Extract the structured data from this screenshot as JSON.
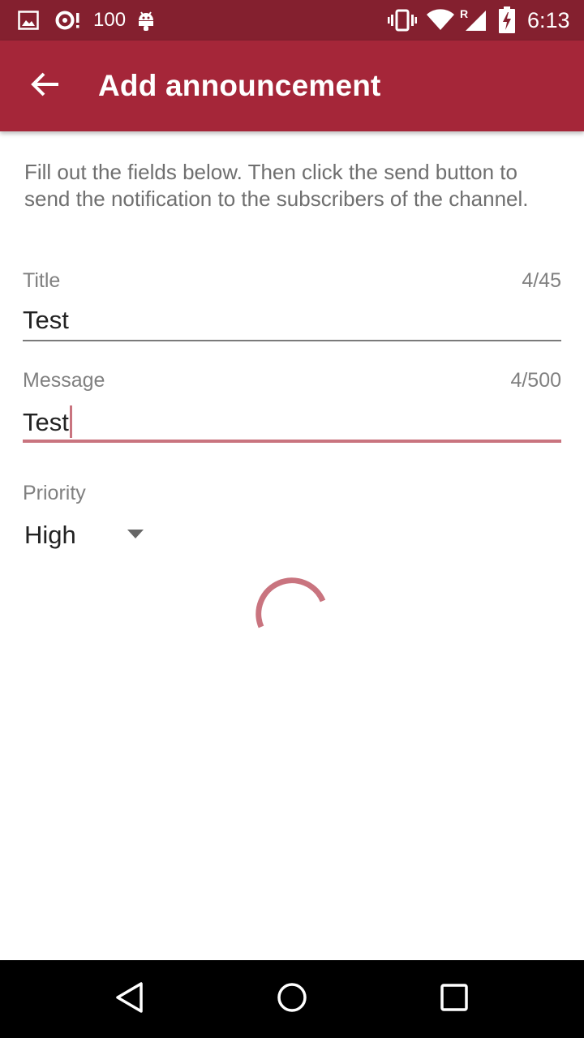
{
  "status_bar": {
    "notification_count": "100",
    "time": "6:13",
    "roaming_indicator": "R",
    "icons": [
      "image-icon",
      "sync-alert-icon",
      "android-icon",
      "vibrate-icon",
      "wifi-icon",
      "signal-icon",
      "battery-charging-icon"
    ]
  },
  "app_bar": {
    "title": "Add announcement",
    "back_icon": "arrow-left-icon",
    "background_color": "#a52639"
  },
  "form": {
    "instructions": "Fill out the fields below. Then click the send button to send the notification to the subscribers of the channel.",
    "title_field": {
      "label": "Title",
      "value": "Test",
      "counter": "4/45"
    },
    "message_field": {
      "label": "Message",
      "value": "Test",
      "counter": "4/500",
      "focused": true
    },
    "priority": {
      "label": "Priority",
      "selected": "High"
    },
    "loading": true
  },
  "colors": {
    "accent": "#c9747f",
    "status_bar": "#84202f"
  },
  "nav_bar": {
    "buttons": [
      "back-triangle-icon",
      "home-circle-icon",
      "recents-square-icon"
    ]
  }
}
